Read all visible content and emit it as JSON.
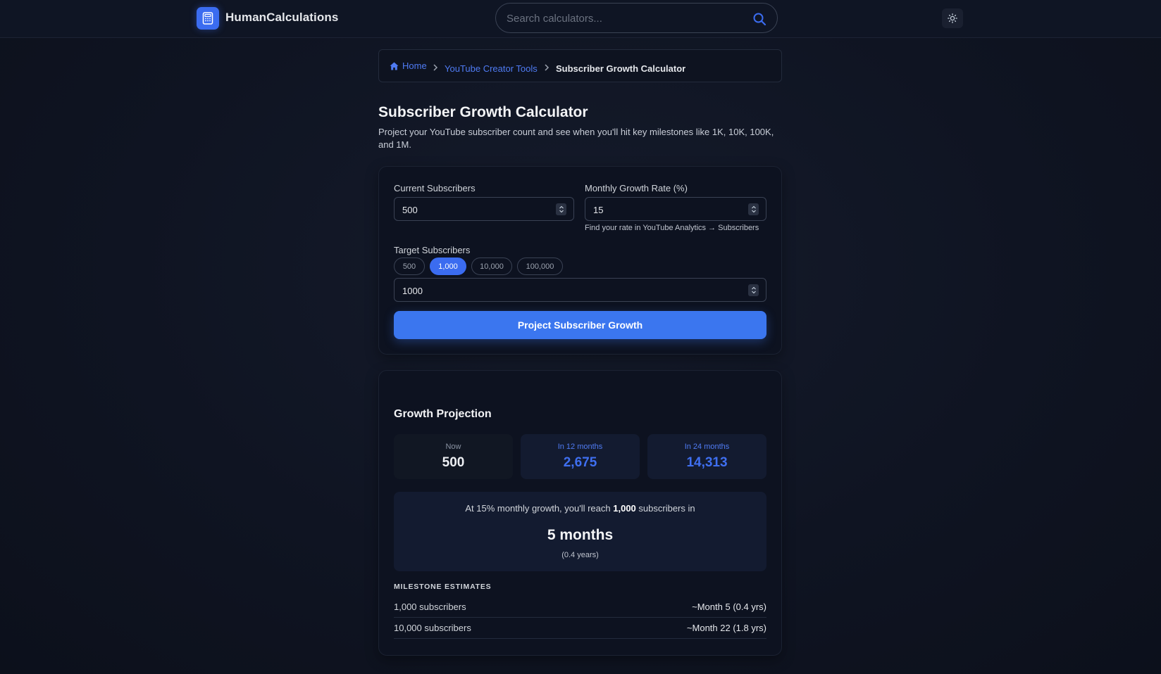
{
  "header": {
    "brand": "HumanCalculations",
    "search_placeholder": "Search calculators..."
  },
  "breadcrumb": {
    "home": "Home",
    "category": "YouTube Creator Tools",
    "current": "Subscriber Growth Calculator"
  },
  "page": {
    "title": "Subscriber Growth Calculator",
    "description": "Project your YouTube subscriber count and see when you'll hit key milestones like 1K, 10K, 100K, and 1M."
  },
  "form": {
    "current_label": "Current Subscribers",
    "current_value": "500",
    "growth_label": "Monthly Growth Rate (%)",
    "growth_value": "15",
    "growth_hint": "Find your rate in YouTube Analytics → Subscribers",
    "target_label": "Target Subscribers",
    "target_presets": [
      "500",
      "1,000",
      "10,000",
      "100,000"
    ],
    "target_selected": "1,000",
    "target_value": "1000",
    "submit_label": "Project Subscriber Growth"
  },
  "results": {
    "title": "Growth Projection",
    "stats": [
      {
        "label": "Now",
        "value": "500"
      },
      {
        "label": "In 12 months",
        "value": "2,675"
      },
      {
        "label": "In 24 months",
        "value": "14,313"
      }
    ],
    "summary_prefix": "At 15% monthly growth, you'll reach",
    "summary_target": "1,000",
    "summary_suffix": "subscribers in",
    "time_main": "5 months",
    "time_sub": "(0.4 years)",
    "milestones_heading": "MILESTONE ESTIMATES",
    "milestones": [
      {
        "label": "1,000 subscribers",
        "value": "~Month 5 (0.4 yrs)"
      },
      {
        "label": "10,000 subscribers",
        "value": "~Month 22 (1.8 yrs)"
      }
    ]
  },
  "colors": {
    "accent": "#3b6cf0",
    "background": "#0f1422",
    "card": "#0d1220"
  }
}
